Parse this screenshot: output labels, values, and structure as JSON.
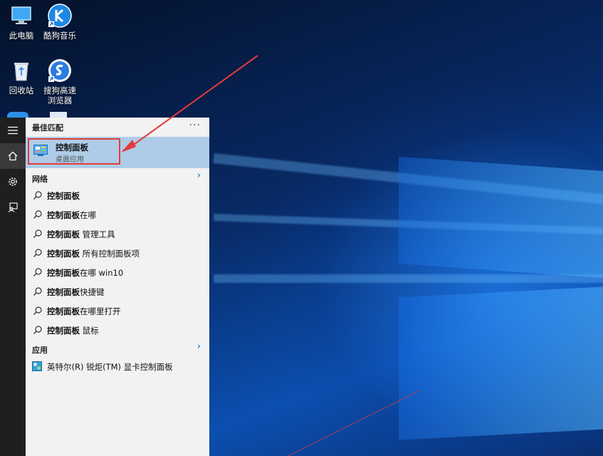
{
  "desktop": {
    "icons": [
      {
        "id": "this-pc",
        "label": "此电脑"
      },
      {
        "id": "kugou",
        "label": "酷狗音乐"
      },
      {
        "id": "recycle-bin",
        "label": "回收站"
      },
      {
        "id": "sogou-browser",
        "label": "搜狗高速\n浏览器"
      }
    ]
  },
  "search_panel": {
    "best_match_header": "最佳匹配",
    "best_match": {
      "title": "控制面板",
      "subtitle": "桌面应用"
    },
    "web_header": "网络",
    "web_results": [
      {
        "bold": "控制面板",
        "rest": ""
      },
      {
        "bold": "控制面板",
        "rest": "在哪"
      },
      {
        "bold": "控制面板",
        "rest": " 管理工具"
      },
      {
        "bold": "控制面板",
        "rest": " 所有控制面板项"
      },
      {
        "bold": "控制面板",
        "rest": "在哪 win10"
      },
      {
        "bold": "控制面板",
        "rest": "快捷键"
      },
      {
        "bold": "控制面板",
        "rest": "在哪里打开"
      },
      {
        "bold": "控制面板",
        "rest": " 鼠标"
      }
    ],
    "apps_header": "应用",
    "apps": [
      {
        "label": "英特尔(R) 锐炬(TM) 显卡控制面板"
      }
    ],
    "more_glyph": "···",
    "chevron_glyph": "›"
  },
  "colors": {
    "highlight_box": "#e23b3b",
    "selected_row": "#aecce8",
    "accent": "#0067c0"
  }
}
